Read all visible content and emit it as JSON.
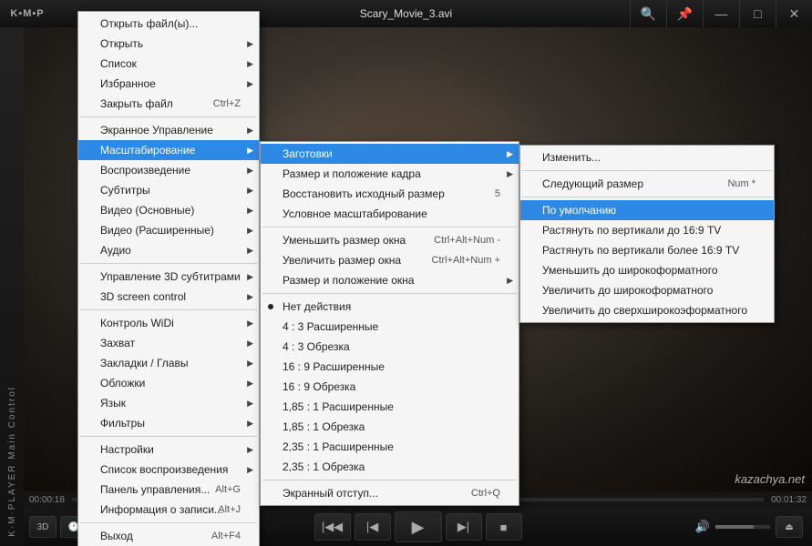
{
  "title": "Scary_Movie_3.avi",
  "logo": "K▪M▪P",
  "strip_text": "K·M·PLAYER  Main Control",
  "watermark": "kazachya.net",
  "time_current": "00:00:18",
  "time_total": "00:01:32",
  "badges": {
    "b1": "3D",
    "b2": "🕐",
    "b3": "⋯"
  },
  "playback": {
    "prev_chapter": "|◀◀",
    "prev": "|◀",
    "play": "▶",
    "next": "▶|",
    "stop": "■",
    "vol_icon": "🔊",
    "eject": "⏏"
  },
  "titlebar_icons": {
    "search": "🔍",
    "pin": "📌",
    "min": "—",
    "max": "□",
    "close": "✕"
  },
  "menu1": [
    {
      "label": "Открыть файл(ы)...",
      "arrow": false
    },
    {
      "label": "Открыть",
      "arrow": true
    },
    {
      "label": "Список",
      "arrow": true
    },
    {
      "label": "Избранное",
      "arrow": true
    },
    {
      "label": "Закрыть файл",
      "shortcut": "Ctrl+Z"
    },
    {
      "sep": true
    },
    {
      "label": "Экранное Управление",
      "arrow": true
    },
    {
      "label": "Масштабирование",
      "arrow": true,
      "selected": true
    },
    {
      "label": "Воспроизведение",
      "arrow": true
    },
    {
      "label": "Субтитры",
      "arrow": true
    },
    {
      "label": "Видео (Основные)",
      "arrow": true
    },
    {
      "label": "Видео (Расширенные)",
      "arrow": true
    },
    {
      "label": "Аудио",
      "arrow": true
    },
    {
      "sep": true
    },
    {
      "label": "Управление 3D субтитрами",
      "arrow": true
    },
    {
      "label": "3D screen control",
      "arrow": true
    },
    {
      "sep": true
    },
    {
      "label": "Контроль WiDi",
      "arrow": true
    },
    {
      "label": "Захват",
      "arrow": true
    },
    {
      "label": "Закладки / Главы",
      "arrow": true
    },
    {
      "label": "Обложки",
      "arrow": true
    },
    {
      "label": "Язык",
      "arrow": true
    },
    {
      "label": "Фильтры",
      "arrow": true
    },
    {
      "sep": true
    },
    {
      "label": "Настройки",
      "arrow": true
    },
    {
      "label": "Список воспроизведения",
      "arrow": true
    },
    {
      "label": "Панель управления...",
      "shortcut": "Alt+G"
    },
    {
      "label": "Информация о записи...",
      "shortcut": "Alt+J"
    },
    {
      "sep": true
    },
    {
      "label": "Выход",
      "shortcut": "Alt+F4"
    }
  ],
  "menu2": [
    {
      "label": "Заготовки",
      "arrow": true,
      "selected": true
    },
    {
      "label": "Размер и положение кадра",
      "arrow": true
    },
    {
      "label": "Восстановить исходный размер",
      "shortcut": "5"
    },
    {
      "label": "Условное масштабирование"
    },
    {
      "sep": true
    },
    {
      "label": "Уменьшить размер окна",
      "shortcut": "Ctrl+Alt+Num -"
    },
    {
      "label": "Увеличить размер окна",
      "shortcut": "Ctrl+Alt+Num +"
    },
    {
      "label": "Размер и положение окна",
      "arrow": true
    },
    {
      "sep": true
    },
    {
      "label": "Нет действия",
      "radio": true
    },
    {
      "label": "4 : 3  Расширенные"
    },
    {
      "label": "4 : 3  Обрезка"
    },
    {
      "label": "16 : 9  Расширенные"
    },
    {
      "label": "16 : 9  Обрезка"
    },
    {
      "label": "1,85 : 1  Расширенные"
    },
    {
      "label": "1,85 : 1  Обрезка"
    },
    {
      "label": "2,35 : 1  Расширенные"
    },
    {
      "label": "2,35 : 1  Обрезка"
    },
    {
      "sep": true
    },
    {
      "label": "Экранный отступ...",
      "shortcut": "Ctrl+Q"
    }
  ],
  "menu3": [
    {
      "label": "Изменить..."
    },
    {
      "sep": true
    },
    {
      "label": "Следующий размер",
      "shortcut": "Num *"
    },
    {
      "sep": true
    },
    {
      "label": "По умолчанию",
      "selected": true
    },
    {
      "label": "Растянуть по вертикали до 16:9 TV"
    },
    {
      "label": "Растянуть по вертикали более 16:9 TV"
    },
    {
      "label": "Уменьшить до широкоформатного"
    },
    {
      "label": "Увеличить до широкоформатного"
    },
    {
      "label": "Увеличить до сверхширокоэформатного"
    }
  ]
}
